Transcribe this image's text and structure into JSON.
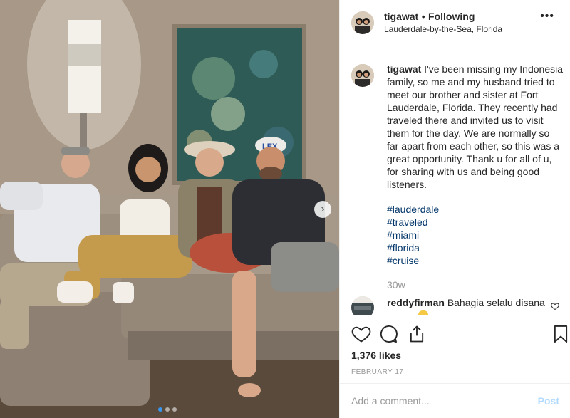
{
  "post": {
    "username": "tigawat",
    "separator": "•",
    "follow_status": "Following",
    "location": "Lauderdale-by-the-Sea, Florida",
    "caption_text": "I've been missing my Indonesia family, so me and my husband tried to meet our brother and sister at Fort Lauderdale, Florida. They recently had traveled there and invited us to visit them for the day. We are normally so far apart from each other, so this was a great opportunity. Thank u for all of u, for sharing with us and being good listeners.",
    "hashtags": [
      "#lauderdale",
      "#traveled",
      "#miami",
      "#florida",
      "#cruise"
    ],
    "time_ago": "30w",
    "comment": {
      "username": "reddyfirman",
      "text": "Bahagia selalu disana"
    },
    "likes": "1,376 likes",
    "date": "FEBRUARY 17",
    "add_comment_placeholder": "Add a comment...",
    "post_label": "Post",
    "photo_lettering": "LEX"
  },
  "icons": {
    "like": "heart-icon",
    "comment": "comment-bubble-icon",
    "share": "share-icon",
    "save": "bookmark-icon",
    "more": "more-options-icon",
    "next": "chevron-right-icon"
  },
  "colors": {
    "hashtag": "#003569",
    "post_button": "#b3dbff",
    "active_dot": "#3897f0",
    "muted_text": "#999999"
  },
  "carousel": {
    "total_slides": 3,
    "active_slide": 1
  }
}
